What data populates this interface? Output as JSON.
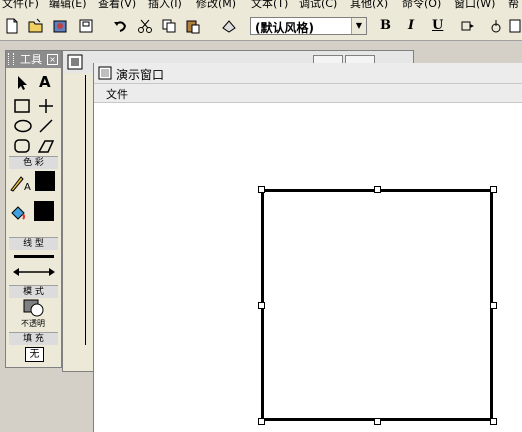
{
  "menubar": {
    "items": [
      "文件(F)",
      "编辑(E)",
      "查看(V)",
      "插入(I)",
      "修改(M)",
      "文本(T)",
      "调试(C)",
      "其他(X)",
      "命令(O)",
      "窗口(W)",
      "帮"
    ]
  },
  "toolbar": {
    "style_select_value": "(默认风格)",
    "bold_label": "B",
    "italic_label": "I",
    "underline_label": "U"
  },
  "tool_panel": {
    "title": "工具",
    "tools": [
      "pointer",
      "text",
      "rectangle",
      "line-cross",
      "ellipse",
      "line",
      "rounded-rectangle",
      "polygon"
    ],
    "section_color": "色 彩",
    "section_line": "线 型",
    "section_mode": "模 式",
    "mode_value": "不透明",
    "section_fill": "填 充",
    "fill_value": "无"
  },
  "demo_window": {
    "title": "演示窗口",
    "menu": [
      "文件"
    ]
  },
  "colors": {
    "app_bg": "#d4d0c8",
    "titlebar_gray": "#8c8c8c",
    "canvas": "#ffffff",
    "shape_stroke": "#000000"
  }
}
